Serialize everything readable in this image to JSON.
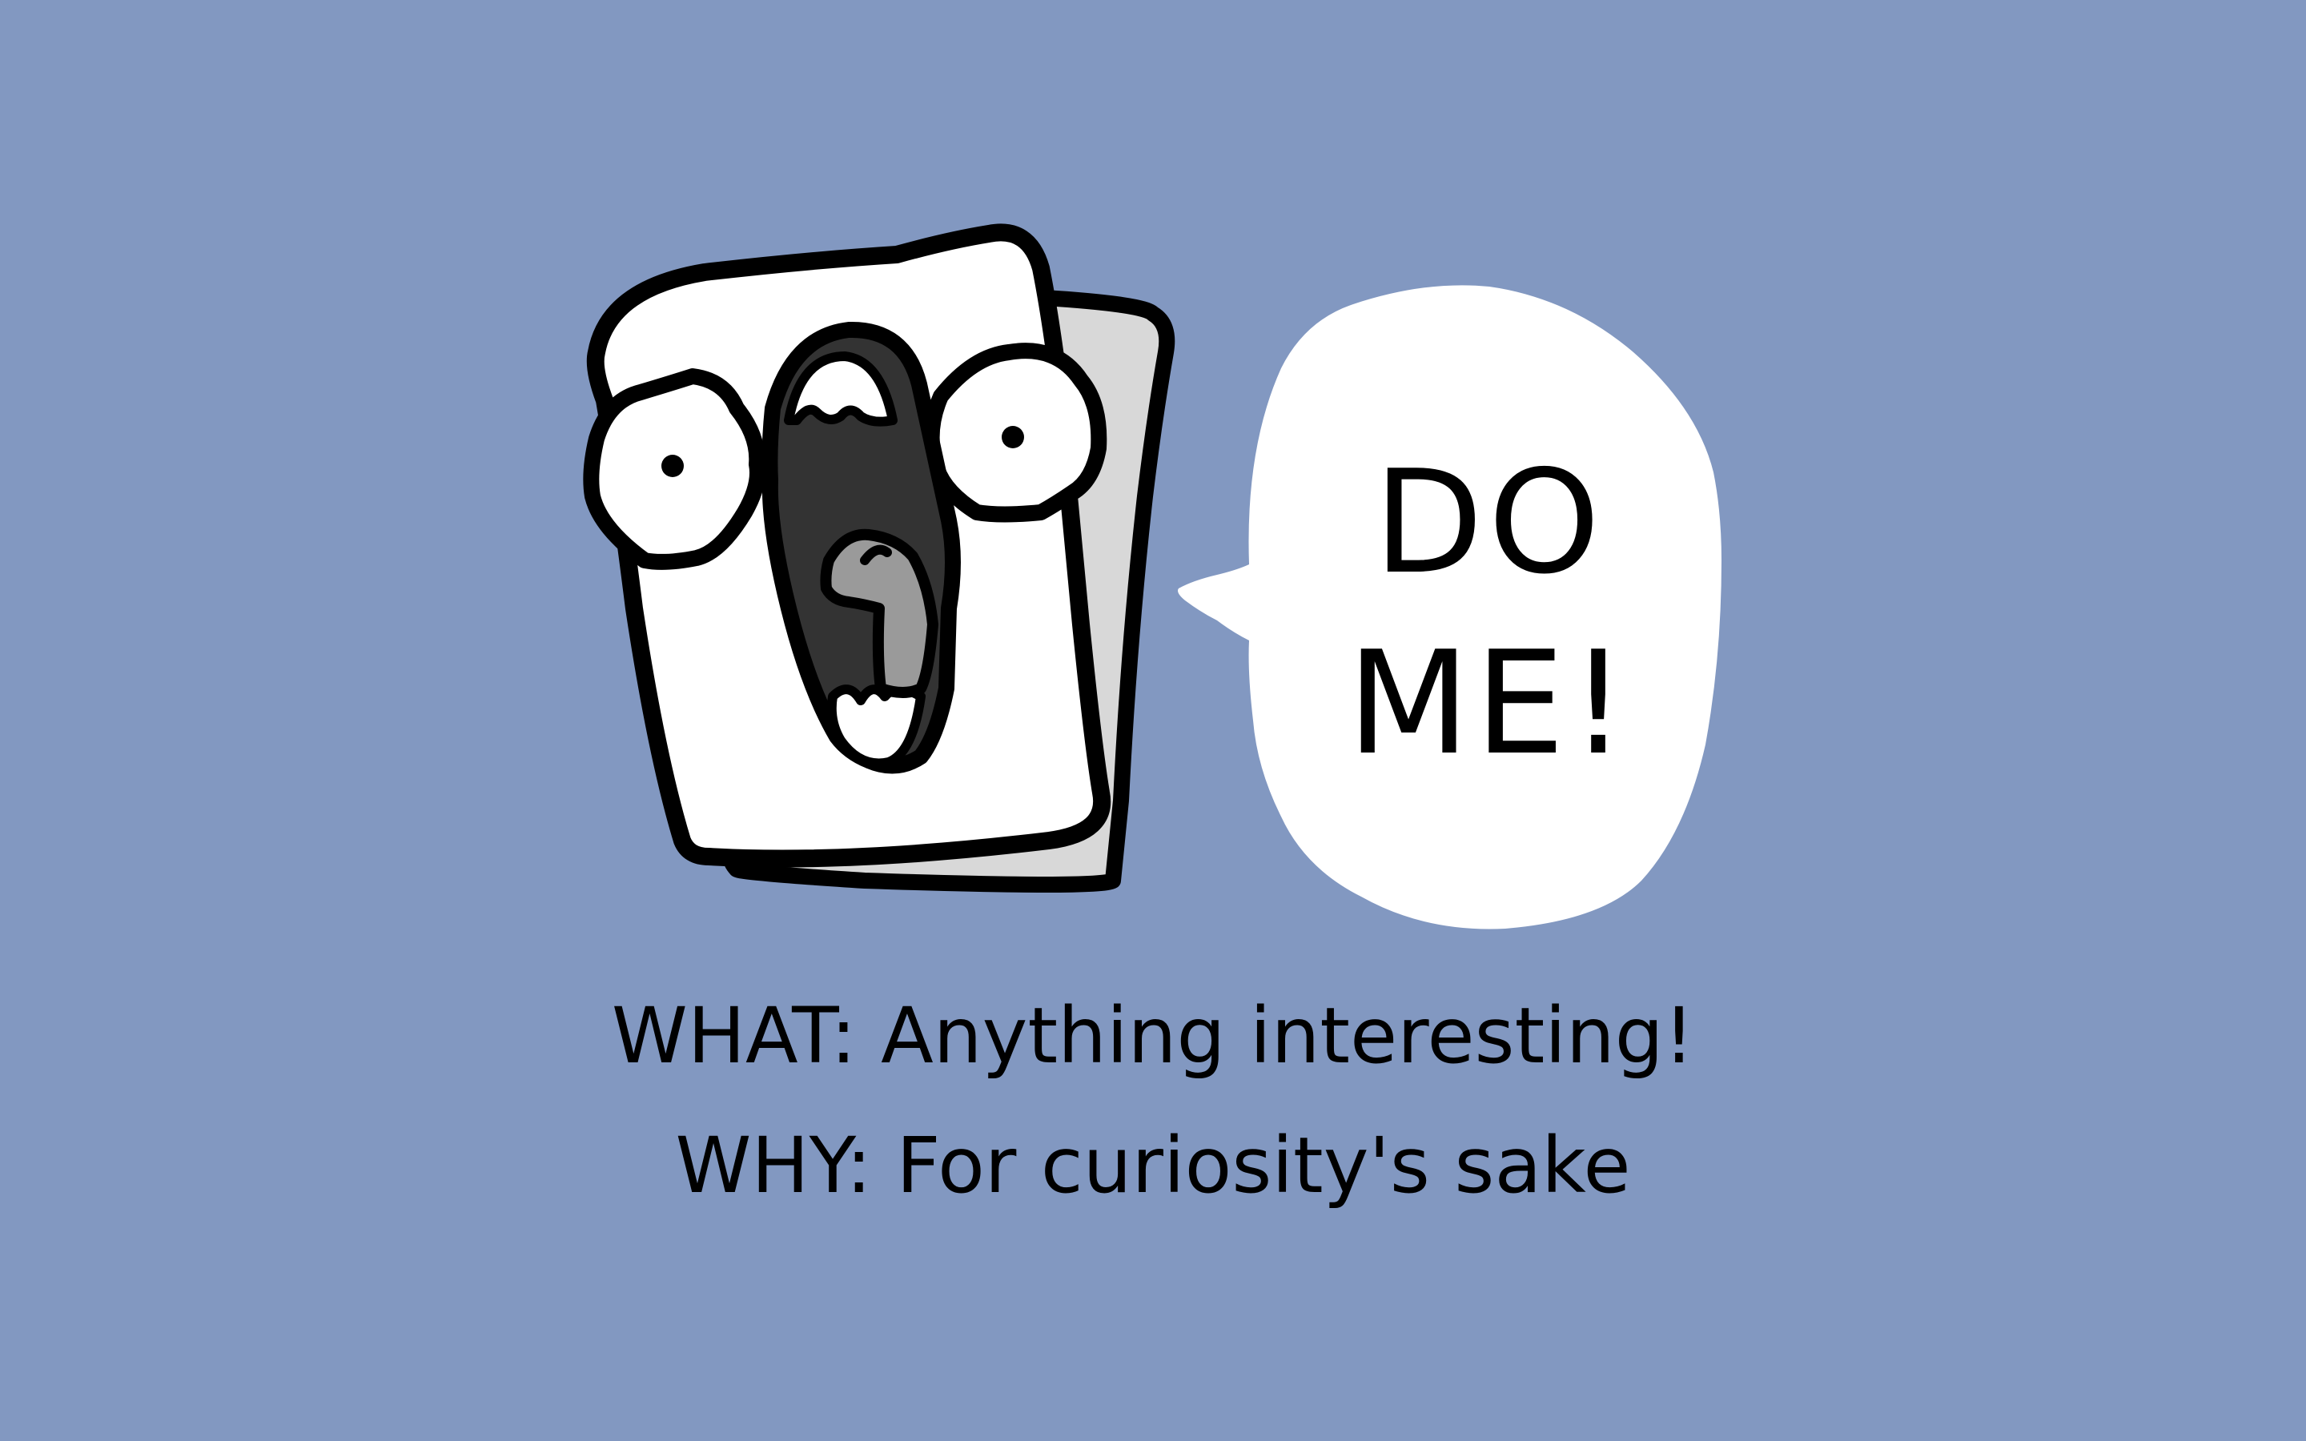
{
  "colors": {
    "background": "#8298c1",
    "outline": "#000000",
    "paper": "#ffffff",
    "back_paper": "#d8d8d8",
    "mouth_dark": "#333333",
    "tongue": "#9a9a9a"
  },
  "bubble": {
    "line1": "DO",
    "line2": "ME!"
  },
  "caption": {
    "what": "WHAT: Anything interesting!",
    "why": "WHY: For curiosity's sake"
  }
}
